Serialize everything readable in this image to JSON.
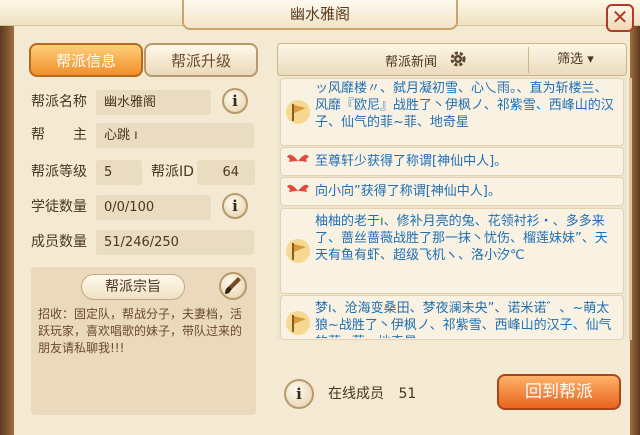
{
  "window": {
    "title": "幽水雅阁",
    "close_label": "✕"
  },
  "tabs": [
    {
      "label": "帮派信息",
      "active": true
    },
    {
      "label": "帮派升级",
      "active": false
    }
  ],
  "info": {
    "name_label": "帮派名称",
    "name_value": "幽水雅阁",
    "leader_label": "帮　　主",
    "leader_value": "心跳 ı",
    "level_label": "帮派等级",
    "level_value": "5",
    "id_label": "帮派ID",
    "id_value": "64",
    "apprentice_label": "学徒数量",
    "apprentice_value": "0/0/100",
    "member_label": "成员数量",
    "member_value": "51/246/250"
  },
  "tenet": {
    "title": "帮派宗旨",
    "text": "招收：固定队，帮战分子，夫妻档，活跃玩家，喜欢唱歌的妹子，带队过来的朋友请私聊我!!!"
  },
  "news": {
    "title": "帮派新闻",
    "filter_label": "筛选 ▾",
    "items": [
      {
        "icon": "battle-flag-icon",
        "text": "ッ风靡楼〃、弑月凝初雪、心乀雨。、直为斩楼兰、风靡『欧尼』战胜了丶伊枫ノ、祁紫雪、西峰山的汉子、仙气的菲~菲、地奇星"
      },
      {
        "icon": "wings-icon",
        "text": "至尊轩少获得了称谓[神仙中人]。"
      },
      {
        "icon": "wings-icon",
        "text": "向小向”获得了称谓[神仙中人]。"
      },
      {
        "icon": "battle-flag-icon",
        "text": "柚柚的老于ı、修补月亮的兔、花领衬衫・、多多来了、蔷丝蔷薇战胜了那一抹丶忧伤、榴莲妹妹”、天天有鱼有虾、超级飞机ヽ、洛小汐℃"
      },
      {
        "icon": "battle-flag-icon",
        "text": "梦ı、沧海变桑田、梦夜澜未央”、诺米诺゛、~萌太狼~战胜了丶伊枫ノ、祁紫雪、西峰山的汉子、仙气的菲~菲、地奇星"
      }
    ]
  },
  "online": {
    "label": "在线成员",
    "count": "51"
  },
  "return_button": "回到帮派",
  "info_icon": "i"
}
